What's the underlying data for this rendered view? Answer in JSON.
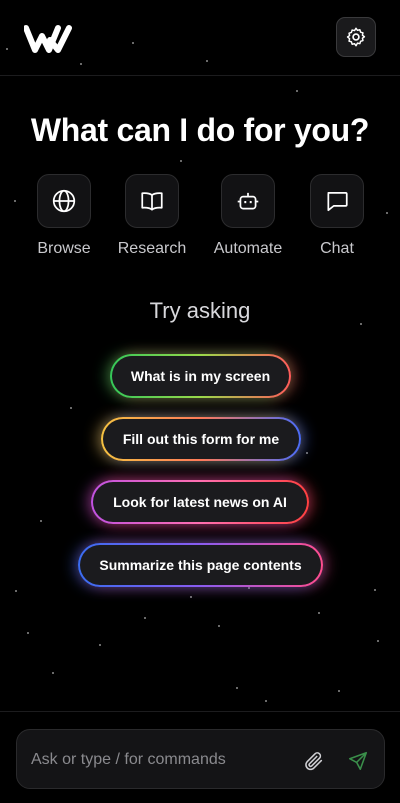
{
  "header": {
    "logo_icon": "w-logo-icon",
    "settings_icon": "gear-icon"
  },
  "hero": {
    "title": "What can I do for you?"
  },
  "modes": [
    {
      "label": "Browse",
      "icon": "globe-icon"
    },
    {
      "label": "Research",
      "icon": "book-icon"
    },
    {
      "label": "Automate",
      "icon": "robot-icon"
    },
    {
      "label": "Chat",
      "icon": "chat-bubble-icon"
    }
  ],
  "suggestions": {
    "heading": "Try asking",
    "items": [
      {
        "label": "What is in my screen",
        "colors": [
          "#35c759",
          "#ff5b5b"
        ]
      },
      {
        "label": "Fill out this form for me",
        "colors": [
          "#f5c242",
          "#4a6cf7"
        ]
      },
      {
        "label": "Look for latest news on AI",
        "colors": [
          "#c052e0",
          "#ff4040"
        ]
      },
      {
        "label": "Summarize this page contents",
        "colors": [
          "#3a6cf0",
          "#ff4d8f"
        ]
      }
    ]
  },
  "composer": {
    "placeholder": "Ask or type / for commands",
    "attach_icon": "paperclip-icon",
    "send_icon": "send-icon",
    "send_color": "#3a8f4a"
  },
  "theme": {
    "background": "#000000",
    "text": "#ffffff"
  }
}
